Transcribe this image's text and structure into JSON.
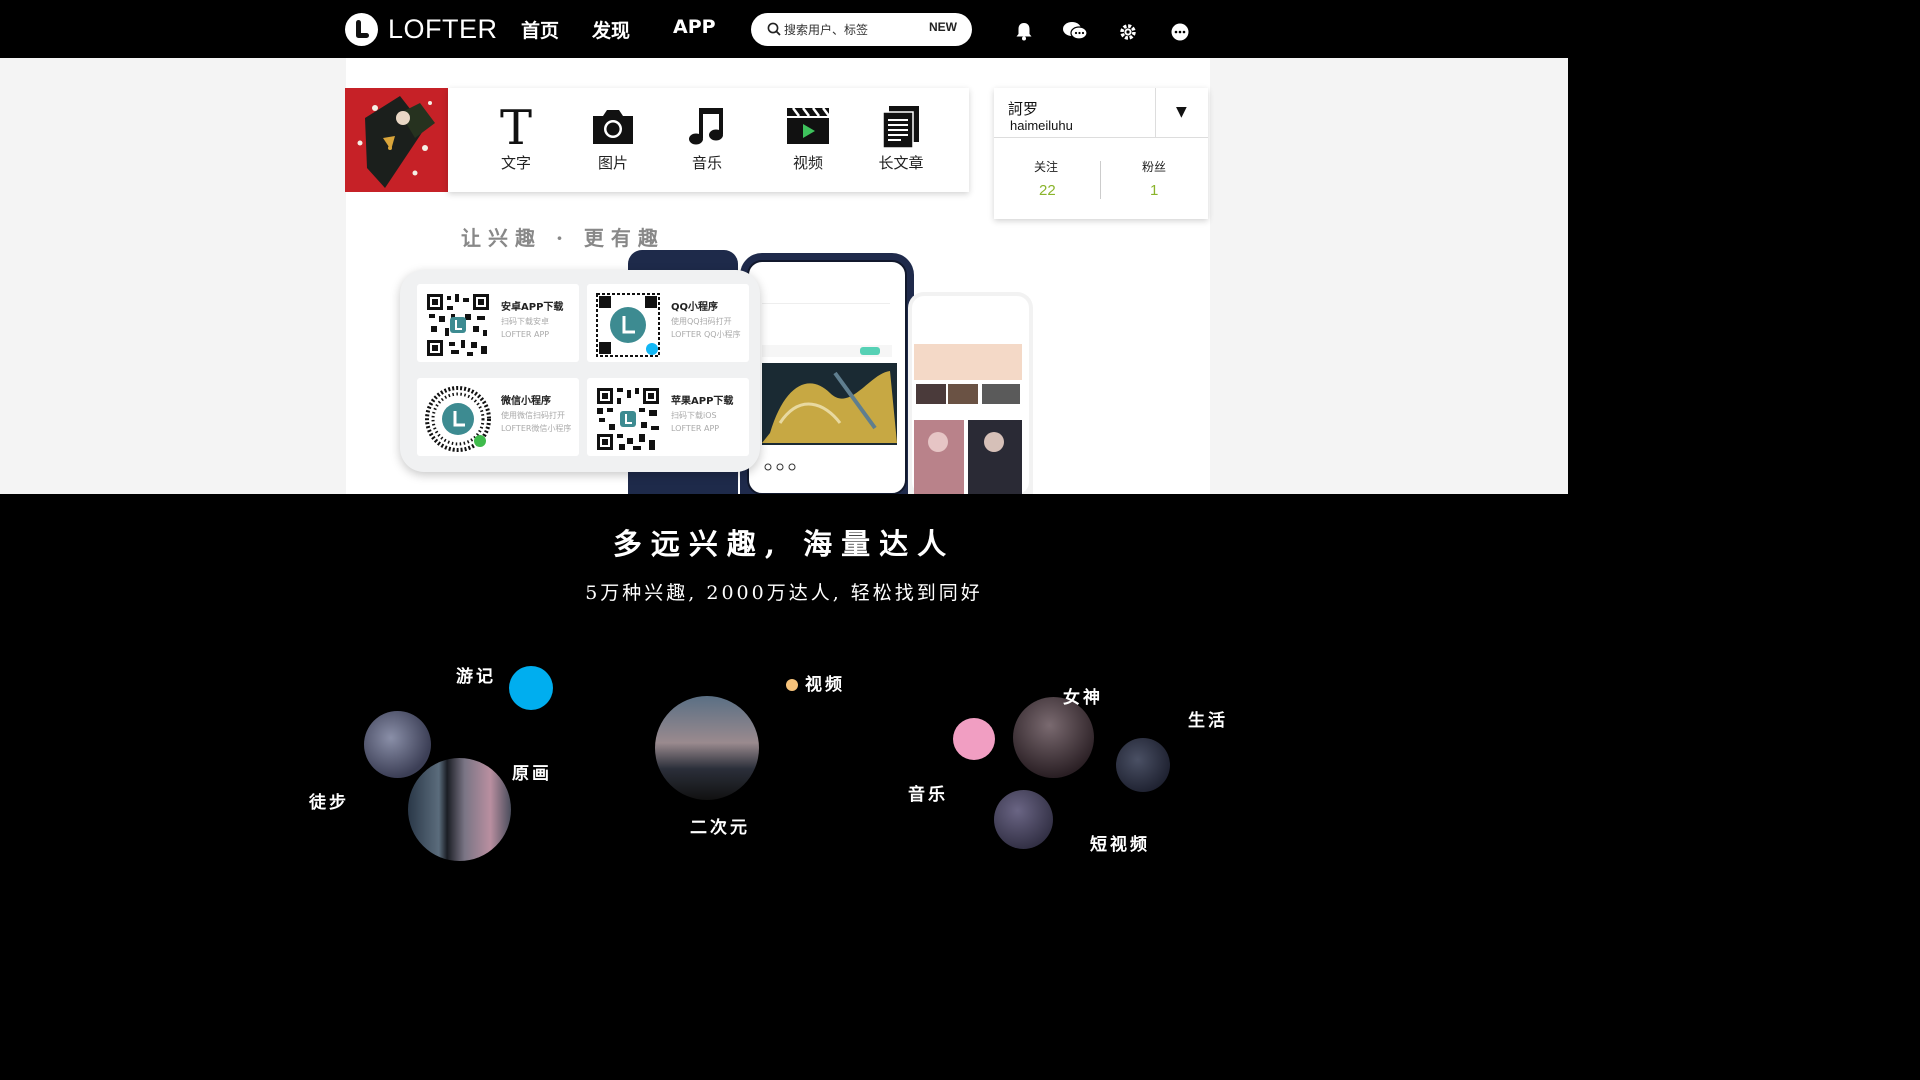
{
  "header": {
    "logo_text": "LOFTER",
    "nav": [
      "首页",
      "发现",
      "APP"
    ],
    "search_placeholder": "搜索用户、标签",
    "new_badge": "NEW"
  },
  "composer": {
    "buttons": [
      {
        "label": "文字",
        "icon": "text-t-icon"
      },
      {
        "label": "图片",
        "icon": "camera-icon"
      },
      {
        "label": "音乐",
        "icon": "music-note-icon"
      },
      {
        "label": "视频",
        "icon": "video-clapper-icon"
      },
      {
        "label": "长文章",
        "icon": "document-icon"
      }
    ]
  },
  "profile": {
    "name": "訶罗",
    "handle": "haimeiluhu",
    "dropdown": "▼",
    "following_label": "关注",
    "following_value": "22",
    "followers_label": "粉丝",
    "followers_value": "1"
  },
  "promo": {
    "slogan": "让兴趣 · 更有趣",
    "qr_codes": [
      {
        "title": "安卓APP下载",
        "desc": "扫码下载安卓LOFTER APP"
      },
      {
        "title": "QQ小程序",
        "desc": "使用QQ扫码打开LOFTER QQ小程序"
      },
      {
        "title": "微信小程序",
        "desc": "使用微信扫码打开LOFTER微信小程序"
      },
      {
        "title": "苹果APP下载",
        "desc": "扫码下载iOS LOFTER APP"
      }
    ]
  },
  "feature": {
    "title": "多远兴趣, 海量达人",
    "subtitle": "5万种兴趣, 2000万达人, 轻松找到同好"
  },
  "interests": [
    "游记",
    "徒步",
    "原画",
    "视频",
    "二次元",
    "女神",
    "生活",
    "音乐",
    "短视频"
  ],
  "colors": {
    "accent_green": "#8ab42b",
    "bubble_blue": "#00aeef",
    "bubble_pink": "#f19ec2",
    "bubble_yellow": "#f5c27a"
  }
}
